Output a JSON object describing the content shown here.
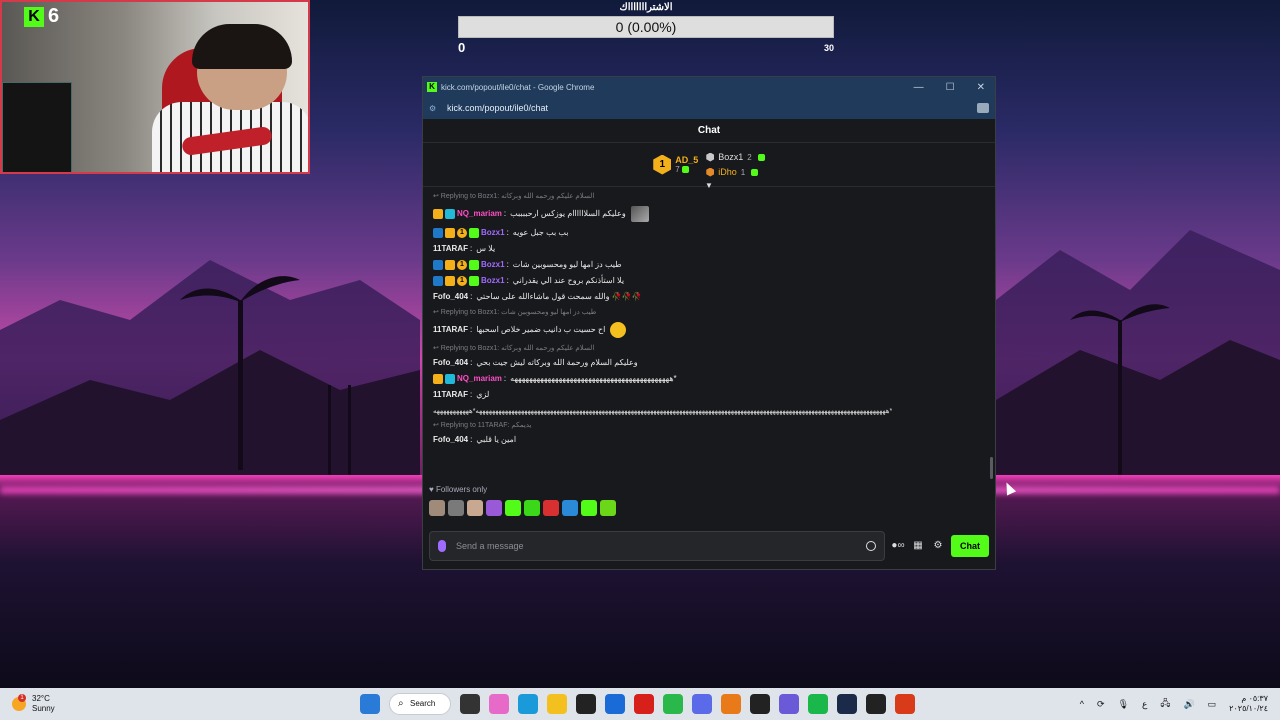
{
  "webcam": {
    "kick_badge": "K",
    "viewer_count": "6"
  },
  "goal": {
    "title": "الاشتراااااااك",
    "progress_text": "0 (0.00%)",
    "progress": 0,
    "min": "0",
    "max": "30"
  },
  "window": {
    "title": "kick.com/popout/ile0/chat - Google Chrome",
    "url": "kick.com/popout/ile0/chat",
    "controls": {
      "minimize": "—",
      "maximize": "☐",
      "close": "✕"
    }
  },
  "chat": {
    "header": "Chat",
    "top_gifters": {
      "first": {
        "rank": "1",
        "name": "AD_5",
        "count": "7"
      },
      "second": {
        "name": "Bozx1",
        "count": "2"
      },
      "third": {
        "name": "iDho",
        "count": "1"
      }
    },
    "messages": [
      {
        "reply": "↩ Replying to Bozx1: السلام عليكم ورحمه الله وبركاته",
        "user": "NQ_mariam",
        "text": "وعليكم السلاااااام يوزكس ارحببببب"
      },
      {
        "user": "Bozx1",
        "text": "بب بب جبل عويه"
      },
      {
        "user": "11TARAF",
        "text": "يلا س"
      },
      {
        "user": "Bozx1",
        "text": "طيب دز امها ليو ومحسوبين شات"
      },
      {
        "user": "Bozx1",
        "text": "يلا استأذنكم بروح عند الي يقدراني"
      },
      {
        "user": "Fofo_404",
        "text": "والله سمحت قول ماشاءالله على ساحتي 🥀🥀🥀"
      },
      {
        "reply": "↩ Replying to Bozx1: طيب دز امها ليو ومحسوبين شات",
        "user": "11TARAF",
        "text": "اح حسيت ب دانيب ضمير خلاص اسحبها"
      },
      {
        "reply": "↩ Replying to Bozx1: السلام عليكم ورحمه الله وبركاته",
        "user": "Fofo_404",
        "text": "وعليكم السلام ورحمة الله وبركاته ليش جيت بحي"
      },
      {
        "user": "NQ_mariam",
        "text": "هههههههههههههههههههههههههههههههههههههههههههه*"
      },
      {
        "user": "11TARAF",
        "text": "لزي"
      },
      {
        "long": "هههههههههههههههههههههههههههههههههههههههههههههههههههههههههههههههههههههههههههههههههههههههههههههههههههههههههههههههههههههههههههههههه*هههههههههههه*"
      },
      {
        "reply": "↩ Replying to 11TARAF: يديمكم",
        "user": "Fofo_404",
        "text": "امين يا قلبي"
      }
    ],
    "followers_label": "♥ Followers only",
    "input_placeholder": "Send a message",
    "send_button": "Chat"
  },
  "taskbar": {
    "weather_temp": "32°C",
    "weather_desc": "Sunny",
    "weather_badge": "1",
    "search_label": "Search",
    "lang": "ع",
    "clock_time": "٠٥:٣٧ م",
    "clock_date": "٢٠٢٥/١٠/٢٤"
  },
  "colors": {
    "kick_green": "#53fc18",
    "gold": "#f3b01b",
    "pink_user": "#ff4ec7",
    "purple_user": "#a16aff"
  }
}
